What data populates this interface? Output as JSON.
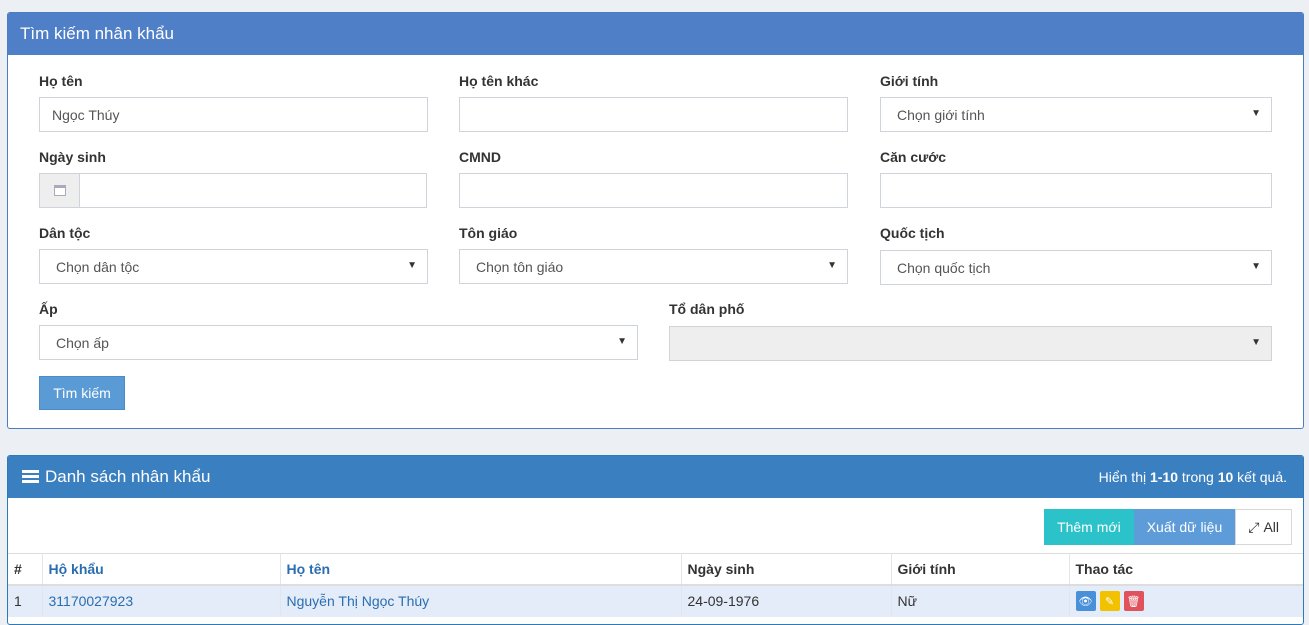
{
  "search": {
    "title": "Tìm kiếm nhân khẩu",
    "labels": {
      "ho_ten": "Họ tên",
      "ho_ten_khac": "Họ tên khác",
      "gioi_tinh": "Giới tính",
      "ngay_sinh": "Ngày sinh",
      "cmnd": "CMND",
      "can_cuoc": "Căn cước",
      "dan_toc": "Dân tộc",
      "ton_giao": "Tôn giáo",
      "quoc_tich": "Quốc tịch",
      "ap": "Ấp",
      "to_dan_pho": "Tổ dân phố"
    },
    "values": {
      "ho_ten": "Ngọc Thúy",
      "ho_ten_khac": "",
      "ngay_sinh": "",
      "cmnd": "",
      "can_cuoc": ""
    },
    "selects": {
      "gioi_tinh": "Chọn giới tính",
      "dan_toc": "Chọn dân tộc",
      "ton_giao": "Chọn tôn giáo",
      "quoc_tich": "Chọn quốc tịch",
      "ap": "Chọn ấp",
      "to_dan_pho": ""
    },
    "button": "Tìm kiếm"
  },
  "list": {
    "title": "Danh sách nhân khẩu",
    "summary_prefix": "Hiển thị ",
    "summary_range": "1-10",
    "summary_mid": " trong ",
    "summary_total": "10",
    "summary_suffix": " kết quả.",
    "toolbar": {
      "add": "Thêm mới",
      "export": "Xuất dữ liệu",
      "all": "All"
    },
    "columns": [
      "#",
      "Hộ khẩu",
      "Họ tên",
      "Ngày sinh",
      "Giới tính",
      "Thao tác"
    ],
    "rows": [
      {
        "no": "1",
        "ho_khau": "31170027923",
        "ho_ten": "Nguyễn Thị Ngọc Thúy",
        "ngay_sinh": "24-09-1976",
        "gioi_tinh": "Nữ"
      }
    ]
  },
  "colors": {
    "header": "#4f7fc6",
    "list_header": "#3a7fbf",
    "add": "#2cc2c9",
    "export": "#5e9cd9"
  }
}
